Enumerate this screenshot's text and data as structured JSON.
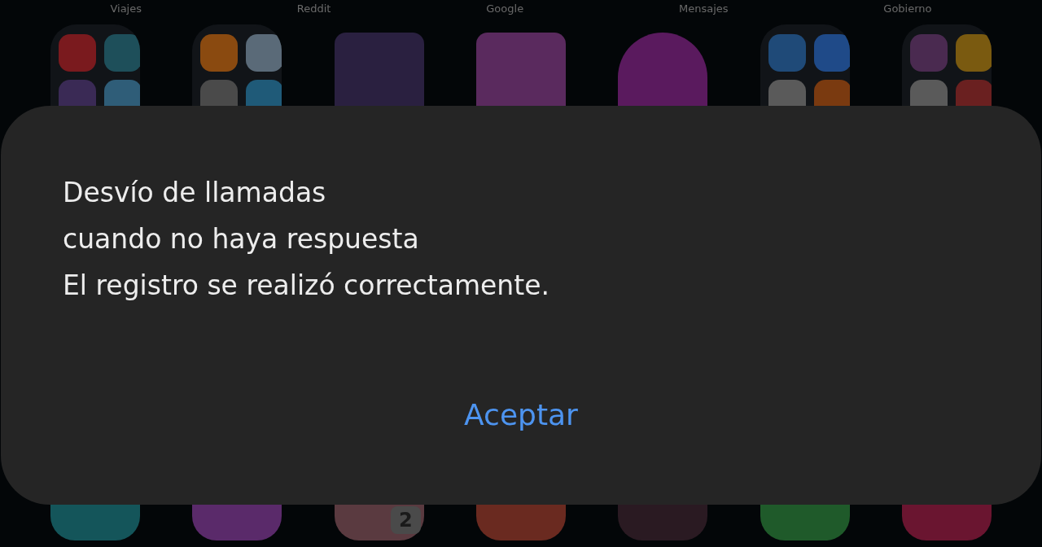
{
  "home_screen": {
    "labels": [
      "Viajes",
      "Reddit",
      "Google",
      "Mensajes",
      "Gobierno"
    ],
    "badge": "2"
  },
  "dialog": {
    "lines": [
      "Desvío de llamadas",
      "cuando no haya respuesta",
      "El registro se realizó correctamente."
    ],
    "button": "Aceptar"
  }
}
